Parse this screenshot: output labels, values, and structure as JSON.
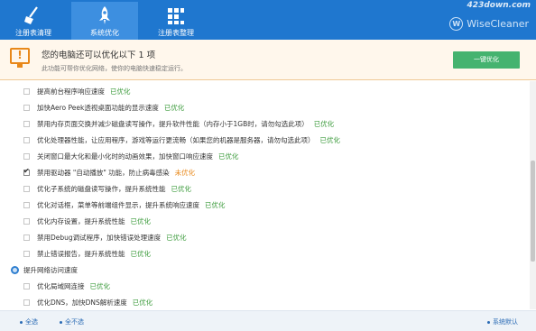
{
  "nav": {
    "tabs": [
      {
        "label": "注册表清理",
        "icon": "broom-icon",
        "active": false
      },
      {
        "label": "系统优化",
        "icon": "rocket-icon",
        "active": true
      },
      {
        "label": "注册表整理",
        "icon": "blocks-icon",
        "active": false
      }
    ],
    "watermark": "423down.com",
    "brand": "WiseCleaner",
    "brand_mark": "W"
  },
  "alert": {
    "title": "您的电脑还可以优化以下 1 项",
    "subtitle": "此功能可帮你优化网络，使你的电脑快速稳定运行。",
    "button": "一键优化"
  },
  "items": [
    {
      "text": "提高前台程序响应速度",
      "status": "已优化",
      "checked": false
    },
    {
      "text": "加快Aero Peek透视桌面功能的显示速度",
      "status": "已优化",
      "checked": false
    },
    {
      "text": "禁用内存页面交换并减少磁盘读写操作，提升软件性能（内存小于1GB时，请勿勾选此项）",
      "status": "已优化",
      "checked": false
    },
    {
      "text": "优化处理器性能，让应用程序，游戏等运行更流畅（如果您的机器是服务器，请勿勾选此项）",
      "status": "已优化",
      "checked": false
    },
    {
      "text": "关闭窗口最大化和最小化时的动画效果，加快窗口响应速度",
      "status": "已优化",
      "checked": false
    },
    {
      "text": "禁用驱动器 \"自动播放\" 功能，防止病毒感染",
      "status": "未优化",
      "checked": true
    },
    {
      "text": "优化子系统的磁盘读写操作，提升系统性能",
      "status": "已优化",
      "checked": false
    },
    {
      "text": "优化对话框，菜单等前端组件显示，提升系统响应速度",
      "status": "已优化",
      "checked": false
    },
    {
      "text": "优化内存设置，提升系统性能",
      "status": "已优化",
      "checked": false
    },
    {
      "text": "禁用Debug调试程序，加快错误处理速度",
      "status": "已优化",
      "checked": false
    },
    {
      "text": "禁止错误报告，提升系统性能",
      "status": "已优化",
      "checked": false
    }
  ],
  "section": {
    "label": "提升网络访问速度"
  },
  "net_items": [
    {
      "text": "优化局域网连接",
      "status": "已优化",
      "checked": false
    },
    {
      "text": "优化DNS，加快DNS解析速度",
      "status": "已优化",
      "checked": false
    }
  ],
  "footer": {
    "select_all": "全选",
    "select_none": "全不选",
    "default": "系统默认"
  }
}
